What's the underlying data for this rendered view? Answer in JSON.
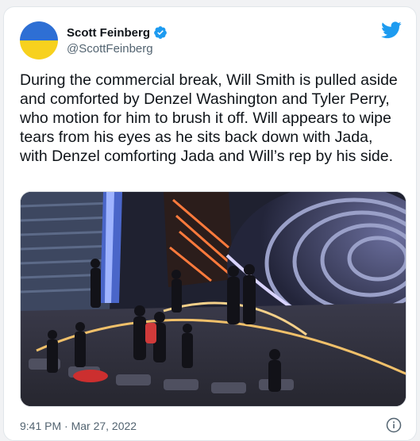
{
  "author": {
    "name": "Scott Feinberg",
    "handle": "@ScottFeinberg",
    "verified": true,
    "avatar_colors": [
      "#2e6fd4",
      "#f7d11e"
    ]
  },
  "tweet": {
    "text": "During the commercial break, Will Smith is pulled aside and comforted by Denzel Washington and Tyler Perry, who motion for him to brush it off. Will appears to wipe tears from his eyes as he sits back down with Jada, with Denzel comforting Jada and Will’s rep by his side."
  },
  "media": {
    "description_icon": "photo-image"
  },
  "meta": {
    "timestamp": "9:41 PM · Mar 27, 2022"
  },
  "icons": {
    "brand": "twitter-bird-icon",
    "verified": "verified-badge-icon",
    "info": "info-icon"
  },
  "colors": {
    "brand": "#1d9bf0",
    "text": "#0f1419",
    "secondary": "#536471"
  }
}
